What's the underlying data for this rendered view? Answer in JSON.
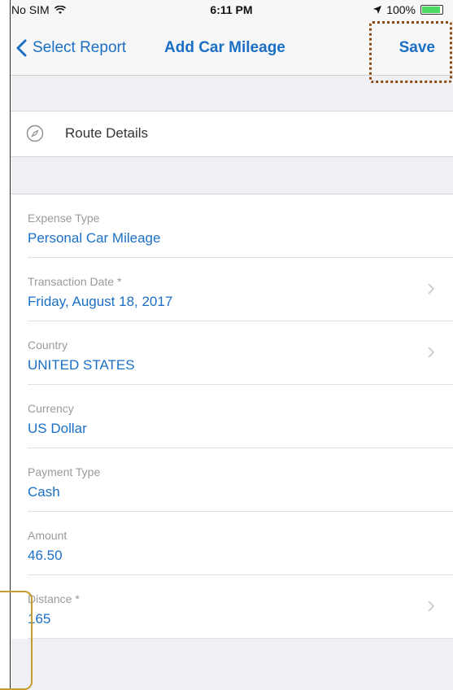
{
  "status_bar": {
    "carrier": "No SIM",
    "time": "6:11 PM",
    "battery": "100%"
  },
  "nav": {
    "back_label": "Select Report",
    "title": "Add Car Mileage",
    "save_label": "Save"
  },
  "route": {
    "label": "Route Details",
    "icon": "compass-icon"
  },
  "fields": [
    {
      "label": "Expense Type",
      "value": "Personal Car Mileage",
      "chevron": false
    },
    {
      "label": "Transaction Date *",
      "value": "Friday, August 18, 2017",
      "chevron": true
    },
    {
      "label": "Country",
      "value": "UNITED STATES",
      "chevron": true
    },
    {
      "label": "Currency",
      "value": "US Dollar",
      "chevron": false
    },
    {
      "label": "Payment Type",
      "value": "Cash",
      "chevron": false
    },
    {
      "label": "Amount",
      "value": "46.50",
      "chevron": false
    },
    {
      "label": "Distance *",
      "value": "165",
      "chevron": true
    }
  ],
  "colors": {
    "accent": "#1a6fc4",
    "background": "#efeff4",
    "label": "#9a9a9e"
  }
}
